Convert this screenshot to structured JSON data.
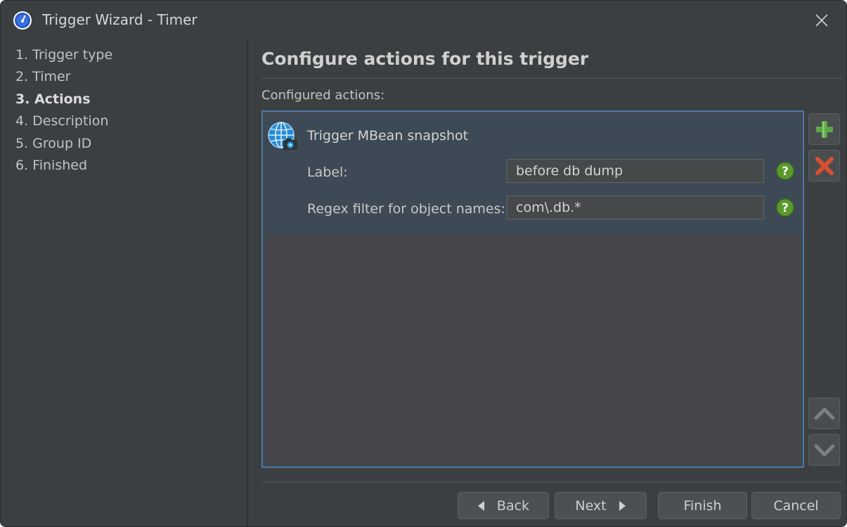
{
  "window": {
    "title": "Trigger Wizard - Timer"
  },
  "steps": [
    {
      "label": "1. Trigger type",
      "active": false
    },
    {
      "label": "2. Timer",
      "active": false
    },
    {
      "label": "3. Actions",
      "active": true
    },
    {
      "label": "4. Description",
      "active": false
    },
    {
      "label": "5. Group ID",
      "active": false
    },
    {
      "label": "6. Finished",
      "active": false
    }
  ],
  "main": {
    "heading": "Configure actions for this trigger",
    "configured_label": "Configured actions:",
    "actions": [
      {
        "name": "Trigger MBean snapshot",
        "icon": "globe-camera-icon",
        "fields": [
          {
            "label": "Label:",
            "value": "before db dump"
          },
          {
            "label": "Regex filter for object names:",
            "value": "com\\.db.*"
          }
        ]
      }
    ]
  },
  "side_buttons": {
    "add": "plus-icon",
    "remove": "x-icon",
    "move_up": "chevron-up-icon",
    "move_down": "chevron-down-icon"
  },
  "footer": {
    "back_label": "Back",
    "next_label": "Next",
    "finish_label": "Finish",
    "cancel_label": "Cancel"
  },
  "colors": {
    "background": "#3c3f41",
    "selection_border": "#4a78a8",
    "selected_row": "#3d4a55",
    "add_green": "#5fa64a",
    "remove_red": "#d9502f",
    "help_green": "#5a9a2a"
  }
}
